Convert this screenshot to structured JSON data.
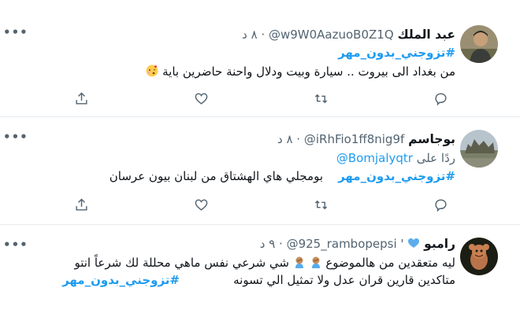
{
  "tweets": [
    {
      "name": "عبد الملك",
      "handle": "@w9W0AazuoB0Z1Q",
      "time": "٨ د",
      "hashtag": "#تزوجني_بدون_مهر",
      "text": "من بغداد الى بيروت .. سيارة وبيت ودلال واحنة حاضرين باية",
      "emoji": "kissing-face-emoji"
    },
    {
      "name": "بوجاسم",
      "handle": "@iRhFio1ff8nig9f",
      "time": "٨ د",
      "reply_prefix": "ردًا على",
      "reply_to": "@Bomjalyqtr",
      "hashtag": "#تزوجني_بدون_مهر",
      "text": "بومجلي هاي الهشتاق من لبنان بيون عرسان"
    },
    {
      "name": "رامبو",
      "handle": "@925_rambopepsi",
      "time": "٩ د",
      "badge": "blue-heart-emoji",
      "text_line1": "ليه متعقدين من هالموضوع",
      "text_line1b": "شي شرعي نفس ماهي محللة لك شرعاً انتو",
      "text_line2": "متاكدين قارين قران عدل ولا تمثيل الي تسونه",
      "hashtag": "#تزوجني_بدون_مهر",
      "emoji": "person-facepalming-emoji"
    }
  ],
  "actions": {
    "reply": "reply-icon",
    "retweet": "retweet-icon",
    "like": "heart-icon",
    "share": "share-icon"
  },
  "colors": {
    "accent": "#1d9bf0",
    "text": "#0f1419",
    "muted": "#536471",
    "border": "#e6ecf0"
  }
}
